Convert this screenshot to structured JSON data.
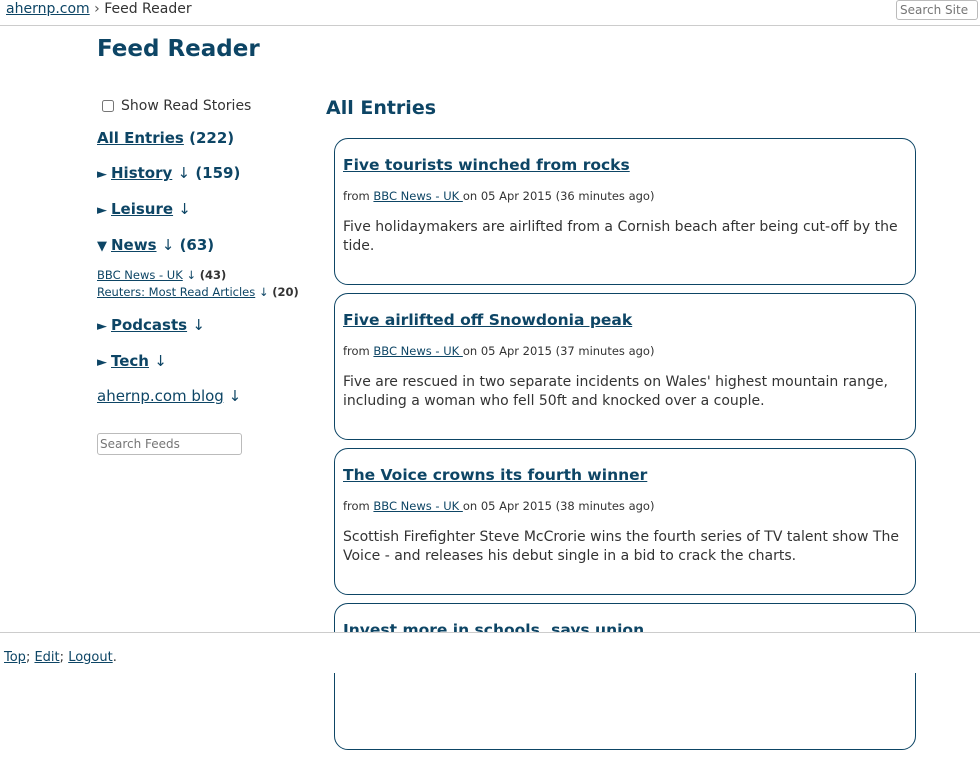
{
  "breadcrumb": {
    "home": "ahernp.com",
    "separator": "›",
    "current": "Feed Reader"
  },
  "site_search": {
    "placeholder": "Search Site"
  },
  "page_title": "Feed Reader",
  "sidebar": {
    "show_read_label": "Show Read Stories",
    "show_read_checked": false,
    "all_entries": {
      "label": "All Entries",
      "count": "(222)"
    },
    "groups": [
      {
        "toggle": "►",
        "label": "History",
        "arrow": "↓",
        "count": "(159)"
      },
      {
        "toggle": "►",
        "label": "Leisure",
        "arrow": "↓",
        "count": ""
      },
      {
        "toggle": "▼",
        "label": "News",
        "arrow": "↓",
        "count": "(63)"
      },
      {
        "toggle": "►",
        "label": "Podcasts",
        "arrow": "↓",
        "count": ""
      },
      {
        "toggle": "►",
        "label": "Tech",
        "arrow": "↓",
        "count": ""
      }
    ],
    "news_feeds": [
      {
        "label": "BBC News - UK",
        "arrow": "↓",
        "count": "(43)"
      },
      {
        "label": "Reuters: Most Read Articles",
        "arrow": "↓",
        "count": "(20)"
      }
    ],
    "blog": {
      "label": "ahernp.com blog",
      "arrow": "↓"
    },
    "feed_search_placeholder": "Search Feeds"
  },
  "main": {
    "heading": "All Entries",
    "entries": [
      {
        "title": "Five tourists winched from rocks",
        "from": "from",
        "source": "BBC News - UK ",
        "on": "on 05 Apr 2015 (36 minutes ago)",
        "description": "Five holidaymakers are airlifted from a Cornish beach after being cut-off by the tide."
      },
      {
        "title": "Five airlifted off Snowdonia peak",
        "from": "from",
        "source": "BBC News - UK ",
        "on": "on 05 Apr 2015 (37 minutes ago)",
        "description": "Five are rescued in two separate incidents on Wales' highest mountain range, including a woman who fell 50ft and knocked over a couple."
      },
      {
        "title": "The Voice crowns its fourth winner",
        "from": "from",
        "source": "BBC News - UK ",
        "on": "on 05 Apr 2015 (38 minutes ago)",
        "description": "Scottish Firefighter Steve McCrorie wins the fourth series of TV talent show The Voice - and releases his debut single in a bid to crack the charts."
      },
      {
        "title": "Invest more in schools, says union",
        "from": "",
        "source": "",
        "on": "",
        "description": ""
      }
    ]
  },
  "footer": {
    "top": "Top",
    "sep1": ";",
    "edit": "Edit",
    "sep2": ";",
    "logout": "Logout",
    "end": "."
  },
  "colors": {
    "accent": "#0d4565",
    "text": "#333333"
  }
}
